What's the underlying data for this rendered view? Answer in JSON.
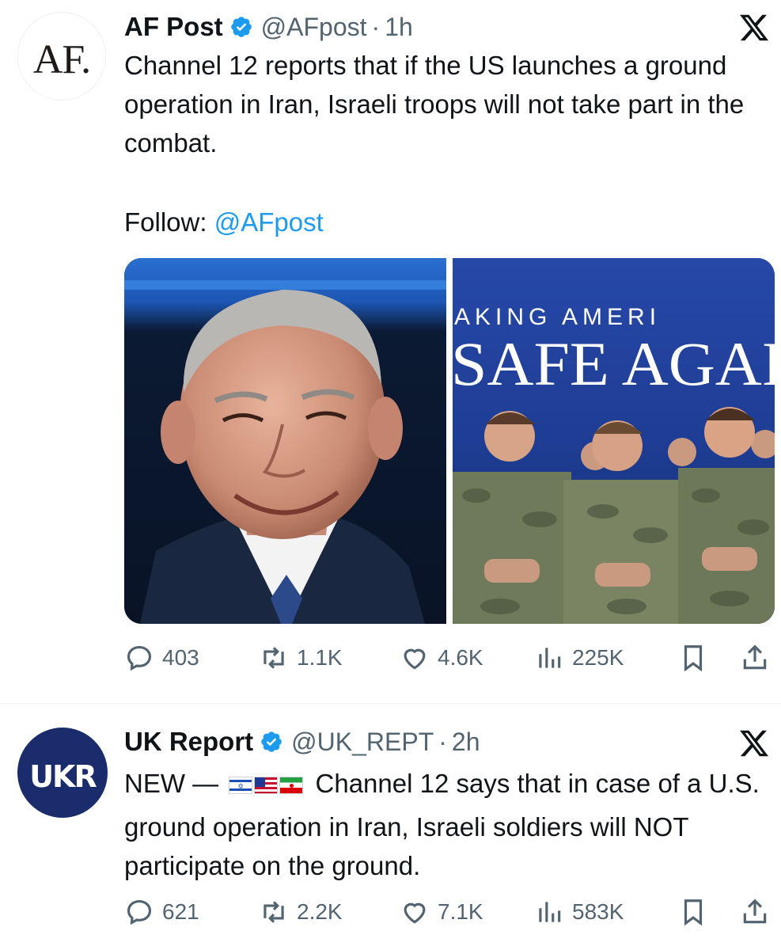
{
  "tweets": [
    {
      "avatar_text": "AF.",
      "name": "AF Post",
      "handle": "@AFpost",
      "separator": "·",
      "time": "1h",
      "text": "Channel 12 reports that if the US launches a ground operation in Iran, Israeli troops will not take part in the combat.",
      "follow_label": "Follow:",
      "follow_handle": "@AFpost",
      "media": [
        {
          "icon": "portrait-photo"
        },
        {
          "icon": "soldiers-photo",
          "banner_top": "AKING AMERI",
          "banner_main": "SAFE AGAI"
        }
      ],
      "metrics": {
        "replies": "403",
        "reposts": "1.1K",
        "likes": "4.6K",
        "views": "225K"
      }
    },
    {
      "avatar_text": "UKR",
      "name": "UK Report",
      "handle": "@UK_REPT",
      "separator": "·",
      "time": "2h",
      "text_prefix": "NEW —",
      "text_flags": [
        "israel-flag",
        "usa-flag",
        "iran-flag"
      ],
      "text": "Channel 12 says that in case of a U.S. ground operation in Iran, Israeli soldiers will NOT participate on the ground.",
      "metrics": {
        "replies": "621",
        "reposts": "2.2K",
        "likes": "7.1K",
        "views": "583K"
      }
    }
  ],
  "colors": {
    "text": "#0f1419",
    "secondary": "#536471",
    "link": "#1d9bf0",
    "verified": "#1d9bf0"
  },
  "icons": [
    "verified-badge-icon",
    "x-logo-icon",
    "reply-icon",
    "repost-icon",
    "like-icon",
    "views-icon",
    "bookmark-icon",
    "share-icon"
  ]
}
